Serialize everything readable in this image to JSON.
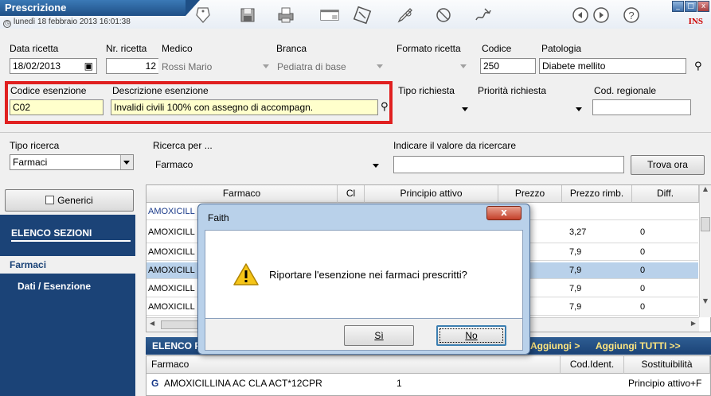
{
  "titlebar": {
    "app_title": "Prescrizione",
    "date_text": "lunedì 18 febbraio 2013  16:01:38",
    "ins_badge": "INS",
    "window_controls": [
      "minimize-icon",
      "maximize-icon",
      "close-icon"
    ],
    "toolbar_icons": [
      "tag-icon",
      "save-icon",
      "printer-icon",
      "window-search-icon",
      "medicine-icon",
      "pencil-edit-icon",
      "stethoscope-icon",
      "signature-icon",
      "back-icon",
      "forward-icon",
      "help-icon"
    ]
  },
  "header": {
    "data_ricetta_label": "Data ricetta",
    "data_ricetta_value": "18/02/2013",
    "nr_ricetta_label": "Nr. ricetta",
    "nr_ricetta_value": "12",
    "medico_label": "Medico",
    "medico_value": "Rossi Mario",
    "branca_label": "Branca",
    "branca_value": "Pediatra di base",
    "formato_label": "Formato ricetta",
    "formato_value": "",
    "codice_label": "Codice",
    "codice_value": "250",
    "patologia_label": "Patologia",
    "patologia_value": "Diabete mellito",
    "codice_esenzione_label": "Codice esenzione",
    "codice_esenzione_value": "C02",
    "descrizione_esenzione_label": "Descrizione esenzione",
    "descrizione_esenzione_value": "Invalidi civili 100% con assegno di accompagn.",
    "tipo_richiesta_label": "Tipo richiesta",
    "priorita_label": "Priorità richiesta",
    "cod_regionale_label": "Cod. regionale"
  },
  "search": {
    "tipo_ricerca_label": "Tipo ricerca",
    "tipo_ricerca_value": "Farmaci",
    "ricerca_per_label": "Ricerca per ...",
    "ricerca_per_value": "Farmaco",
    "valore_label": "Indicare il valore da ricercare",
    "valore_value": "",
    "trova_button": "Trova ora"
  },
  "sidebar": {
    "generici_label": "Generici",
    "elenco_sezioni": "ELENCO SEZIONI",
    "items": [
      {
        "label": "Farmaci"
      },
      {
        "label": "Dati / Esenzione"
      }
    ]
  },
  "grid": {
    "columns": [
      "Farmaco",
      "Cl",
      "Principio attivo",
      "Prezzo",
      "Prezzo rimb.",
      "Diff."
    ],
    "rows": [
      {
        "farmaco": "AMOXICILL",
        "prezzo_rimb": "",
        "diff": ""
      },
      {
        "farmaco": "AMOXICILL",
        "prezzo_rimb": "3,27",
        "diff": "0"
      },
      {
        "farmaco": "AMOXICILL",
        "prezzo_rimb": "7,9",
        "diff": "0"
      },
      {
        "farmaco": "AMOXICILL",
        "prezzo_rimb": "7,9",
        "diff": "0"
      },
      {
        "farmaco": "AMOXICILL",
        "prezzo_rimb": "7,9",
        "diff": "0"
      },
      {
        "farmaco": "AMOXICILL",
        "prezzo_rimb": "7,9",
        "diff": "0"
      }
    ]
  },
  "elenco_bar": {
    "label": "ELENCO F",
    "aggiungi": "Aggiungi >",
    "aggiungi_tutti": "Aggiungi TUTTI >>"
  },
  "prescribed": {
    "columns": [
      "Farmaco",
      "Cod.Ident.",
      "Sostituibilità"
    ],
    "row": {
      "badge": "G",
      "farmaco": "AMOXICILLINA AC CLA ACT*12CPR",
      "qty": "1",
      "sostituibilita": "Principio attivo+F"
    }
  },
  "dialog": {
    "title": "Faith",
    "message": "Riportare l'esenzione nei farmaci prescritti?",
    "yes": "Sì",
    "no": "No",
    "close": "x"
  }
}
